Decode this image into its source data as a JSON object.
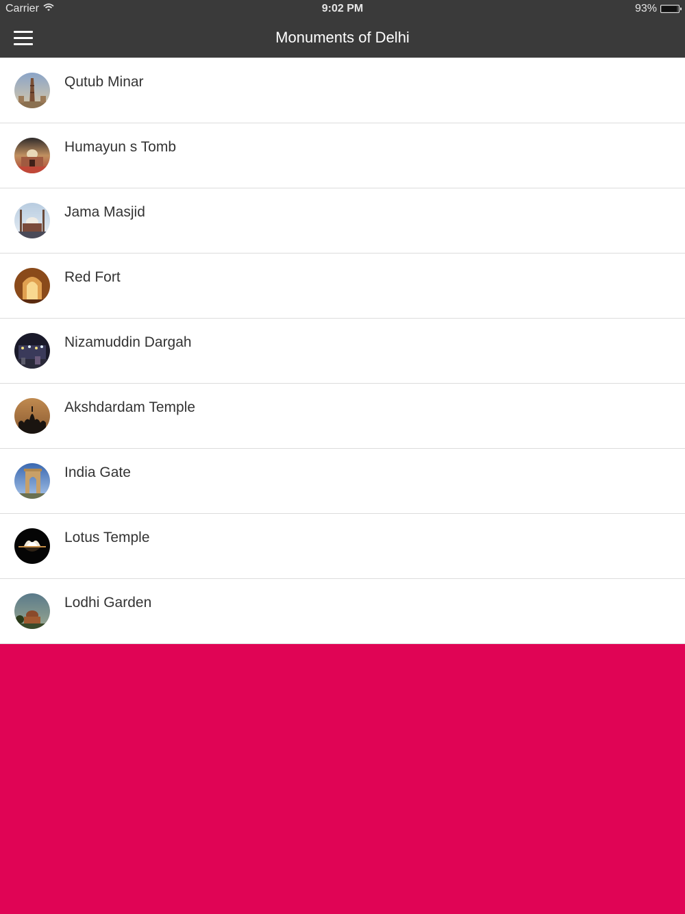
{
  "status_bar": {
    "carrier": "Carrier",
    "time": "9:02 PM",
    "battery_text": "93%",
    "battery_level": 0.93
  },
  "nav": {
    "title": "Monuments of Delhi",
    "menu_icon": "hamburger-menu-icon"
  },
  "monuments": [
    {
      "label": "Qutub Minar",
      "thumb": "qutub-minar-thumbnail"
    },
    {
      "label": "Humayun s Tomb",
      "thumb": "humayuns-tomb-thumbnail"
    },
    {
      "label": "Jama Masjid",
      "thumb": "jama-masjid-thumbnail"
    },
    {
      "label": "Red Fort",
      "thumb": "red-fort-thumbnail"
    },
    {
      "label": "Nizamuddin Dargah",
      "thumb": "nizamuddin-dargah-thumbnail"
    },
    {
      "label": "Akshdardam Temple",
      "thumb": "akshardham-temple-thumbnail"
    },
    {
      "label": "India Gate",
      "thumb": "india-gate-thumbnail"
    },
    {
      "label": "Lotus Temple",
      "thumb": "lotus-temple-thumbnail"
    },
    {
      "label": "Lodhi Garden",
      "thumb": "lodhi-garden-thumbnail"
    }
  ],
  "colors": {
    "header_bg": "#3a3a3a",
    "footer_bg": "#e00455",
    "divider": "#dcdcdc",
    "text": "#333333"
  }
}
